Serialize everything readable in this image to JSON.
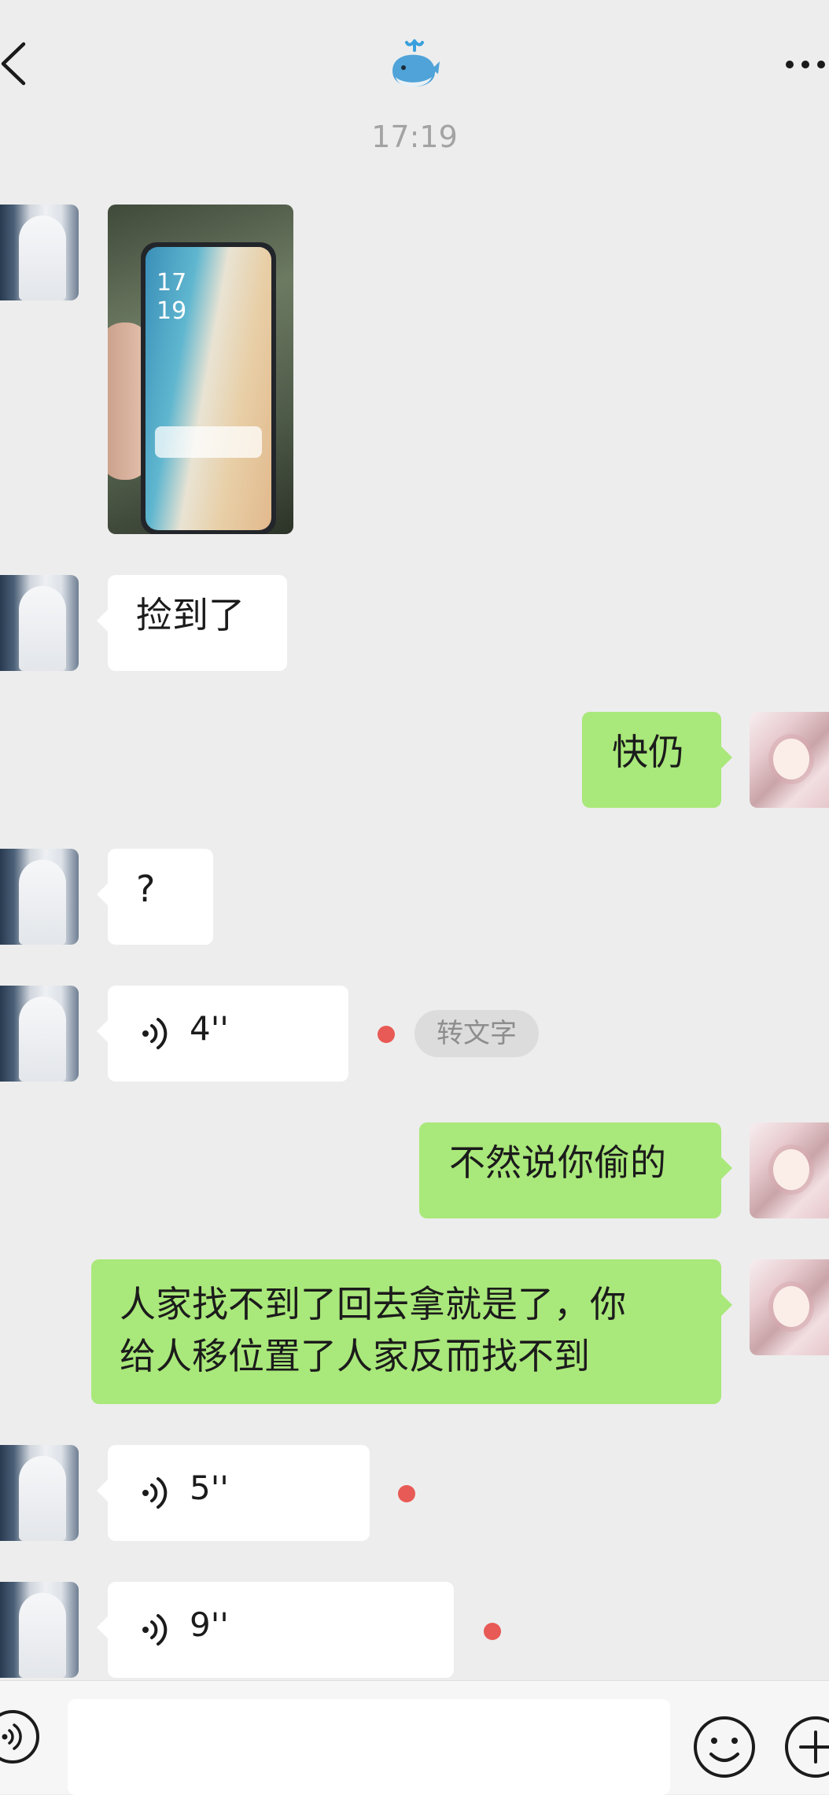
{
  "header": {
    "back_icon": "chevron-left-icon",
    "title_icon": "whale-emoji",
    "more_icon": "more-dots-icon"
  },
  "timestamp": "17:19",
  "messages": [
    {
      "side": "left",
      "type": "image",
      "description_icon": "photo-of-phone"
    },
    {
      "side": "left",
      "type": "text",
      "text": "捡到了"
    },
    {
      "side": "right",
      "type": "text",
      "text": "快仍"
    },
    {
      "side": "left",
      "type": "text",
      "text": "?"
    },
    {
      "side": "left",
      "type": "voice",
      "duration": "4''",
      "unread": true,
      "action": "转文字"
    },
    {
      "side": "right",
      "type": "text",
      "text": "不然说你偷的"
    },
    {
      "side": "right",
      "type": "text",
      "lines": [
        "人家找不到了回去拿就是了，你",
        "给人移位置了人家反而找不到"
      ]
    },
    {
      "side": "left",
      "type": "voice",
      "duration": "5''",
      "unread": true
    },
    {
      "side": "left",
      "type": "voice",
      "duration": "9''",
      "unread": true
    }
  ],
  "photo": {
    "screen_time": [
      "17",
      "19"
    ]
  },
  "colors": {
    "background": "#ededed",
    "bubble_self": "#a9e87a",
    "bubble_other": "#ffffff",
    "unread_dot": "#e85a55"
  },
  "input_bar": {
    "voice_icon": "voice-mode-icon",
    "input_value": "",
    "emoji_icon": "emoji-icon",
    "plus_icon": "plus-icon"
  }
}
